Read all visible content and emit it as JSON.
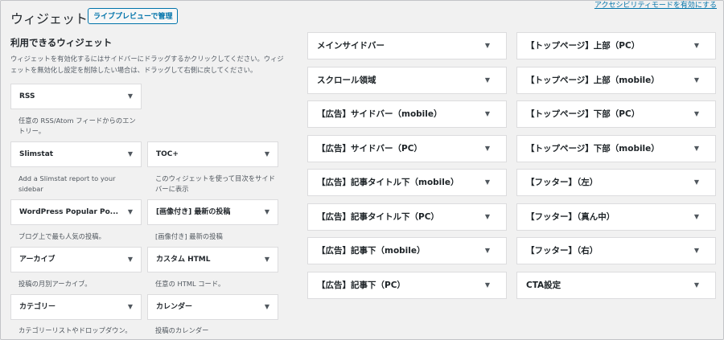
{
  "header": {
    "title": "ウィジェット",
    "preview_button": "ライブプレビューで管理",
    "accessibility_link": "アクセシビリティモードを有効にする"
  },
  "available": {
    "heading": "利用できるウィジェット",
    "description": "ウィジェットを有効化するにはサイドバーにドラッグするかクリックしてください。ウィジェットを無効化し設定を削除したい場合は、ドラッグして右側に戻してください。",
    "widgets": [
      {
        "title": "RSS",
        "desc": "任意の RSS/Atom フィードからのエントリー。"
      },
      {
        "title": "Slimstat",
        "desc": "Add a Slimstat report to your sidebar"
      },
      {
        "title": "TOC+",
        "desc": "このウィジェットを使って目次をサイドバーに表示"
      },
      {
        "title": "WordPress Popular Po...",
        "desc": "ブログ上で最も人気の投稿。"
      },
      {
        "title": "[画像付き] 最新の投稿",
        "desc": "[画像付き] 最新の投稿"
      },
      {
        "title": "アーカイブ",
        "desc": "投稿の月別アーカイブ。"
      },
      {
        "title": "カスタム HTML",
        "desc": "任意の HTML コード。"
      },
      {
        "title": "カテゴリー",
        "desc": "カテゴリーリストやドロップダウン。"
      },
      {
        "title": "カレンダー",
        "desc": "投稿のカレンダー"
      }
    ],
    "caret": "▼"
  },
  "sidebars": {
    "left": [
      "メインサイドバー",
      "スクロール領域",
      "【広告】サイドバー（mobile）",
      "【広告】サイドバー（PC）",
      "【広告】記事タイトル下（mobile）",
      "【広告】記事タイトル下（PC）",
      "【広告】記事下（mobile）",
      "【広告】記事下（PC）"
    ],
    "right": [
      "【トップページ】上部（PC）",
      "【トップページ】上部（mobile）",
      "【トップページ】下部（PC）",
      "【トップページ】下部（mobile）",
      "【フッター】（左）",
      "【フッター】（真ん中）",
      "【フッター】（右）",
      "CTA設定"
    ],
    "caret": "▼"
  }
}
